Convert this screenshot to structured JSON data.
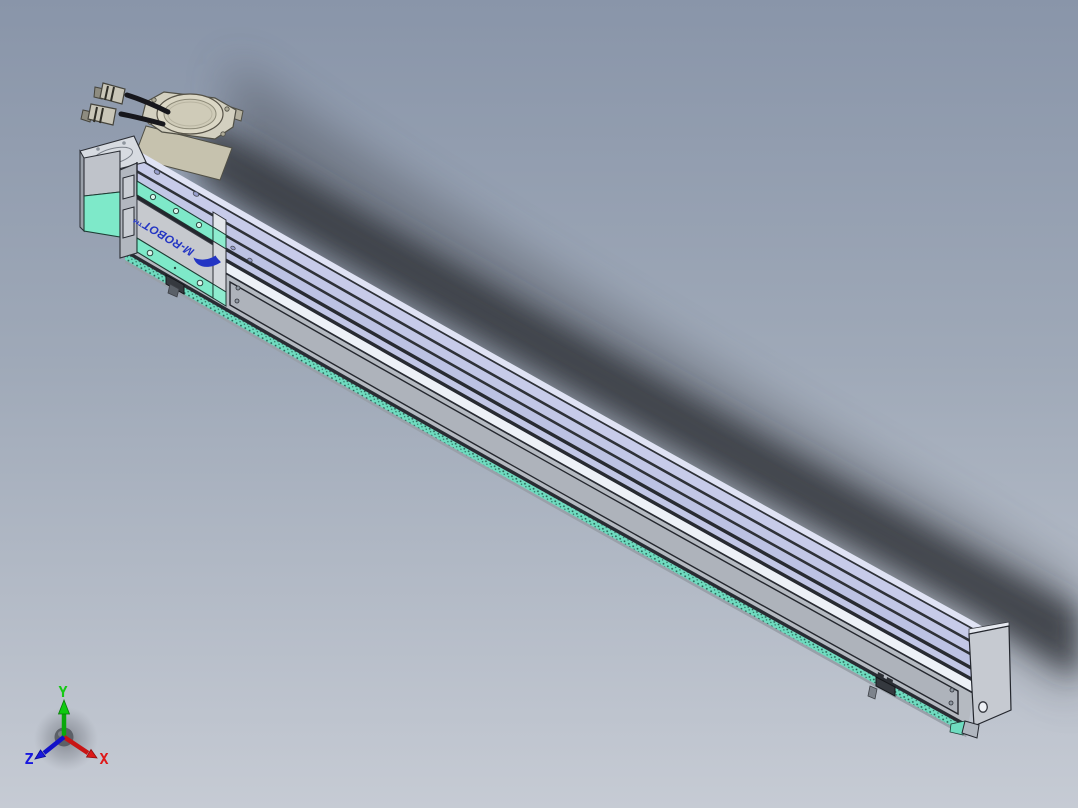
{
  "viewport": {
    "description": "3D CAD viewport showing a long linear actuator rail assembly in isometric view",
    "background_top": "#8995a9",
    "background_bottom": "#c6cbd4",
    "shadow_color": "#31353b"
  },
  "orientation_triad": {
    "x_label": "X",
    "y_label": "Y",
    "z_label": "Z",
    "x_color": "#df1818",
    "y_color": "#15c915",
    "z_color": "#1818df"
  },
  "model": {
    "name": "linear-actuator-rail-assembly",
    "carriage_logo": "M-ROBOT™",
    "colors": {
      "rail_top_surface": "#c7cbe9",
      "rail_side_face": "#b5bac1",
      "rail_highlight": "#edf1f7",
      "accent_teal": "#7ee9c9",
      "motor_beige": "#d3d0c0",
      "logo_blue": "#2335c4",
      "edge_dark": "#282b32"
    },
    "parts": [
      {
        "name": "stepper-motor"
      },
      {
        "name": "motor-cable-connectors"
      },
      {
        "name": "motor-end-block"
      },
      {
        "name": "carriage"
      },
      {
        "name": "extrusion-rail"
      },
      {
        "name": "end-cap"
      },
      {
        "name": "limit-sensors"
      }
    ]
  }
}
